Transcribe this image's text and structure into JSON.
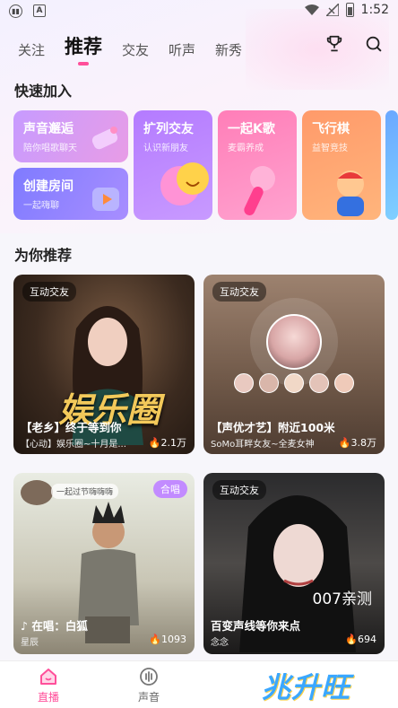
{
  "status_bar": {
    "time": "1:52"
  },
  "tabs": [
    {
      "label": "关注",
      "active": false
    },
    {
      "label": "推荐",
      "active": true
    },
    {
      "label": "交友",
      "active": false
    },
    {
      "label": "听声",
      "active": false
    },
    {
      "label": "新秀",
      "active": false
    }
  ],
  "icons": {
    "trophy": "trophy-icon",
    "search": "search-icon"
  },
  "quick_join": {
    "title": "快速加入",
    "cards": [
      {
        "title": "声音邂逅",
        "subtitle": "陪你唱歌聊天"
      },
      {
        "title": "创建房间",
        "subtitle": "一起嗨聊"
      },
      {
        "title": "扩列交友",
        "subtitle": "认识新朋友"
      },
      {
        "title": "一起K歌",
        "subtitle": "麦霸养成"
      },
      {
        "title": "飞行棋",
        "subtitle": "益智竞技"
      }
    ]
  },
  "recommend": {
    "title": "为你推荐",
    "rooms": [
      {
        "badge": "互动交友",
        "title": "【老乡】终于等到你",
        "subtitle": "【心动】娱乐圈~十月是...",
        "count": "2.1万",
        "overlay_text": "娱乐圈"
      },
      {
        "badge": "互动交友",
        "title": "【声优才艺】附近100米",
        "subtitle": "SoMo耳畔女友~全麦女神",
        "count": "3.8万"
      },
      {
        "badge": "",
        "tag": "合唱",
        "title": "在唱：白狐",
        "subtitle": "星辰",
        "count": "1093",
        "overlay_text": "一起过节嗨嗨嗨"
      },
      {
        "badge": "互动交友",
        "title": "百变声线等你来点",
        "subtitle": "念念",
        "count": "694",
        "overlay_text": "007亲测"
      }
    ]
  },
  "bottom_nav": [
    {
      "label": "直播",
      "active": true
    },
    {
      "label": "声音",
      "active": false
    }
  ],
  "watermark": "兆升旺",
  "colors": {
    "accent": "#ff4f9a"
  }
}
